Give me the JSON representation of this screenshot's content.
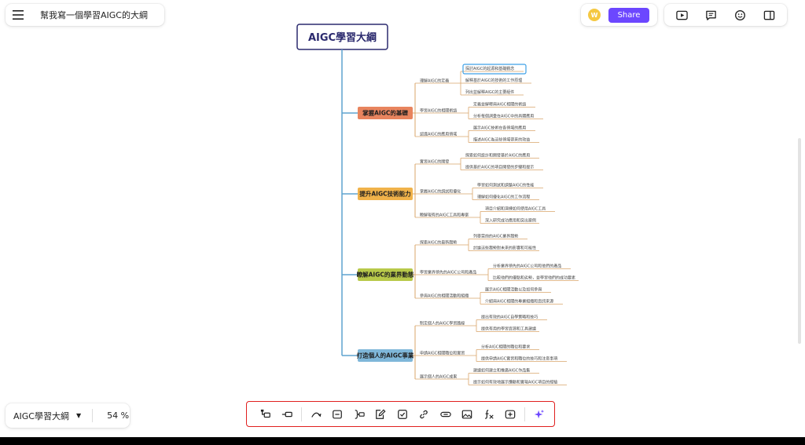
{
  "header": {
    "menu_icon": "hamburger-icon",
    "title": "幫我寫一個學習AIGC的大綱"
  },
  "share": {
    "avatar_letter": "W",
    "avatar_color": "#f5c842",
    "button_label": "Share",
    "button_color": "#6c47ff"
  },
  "top_tools": [
    "presentation-icon",
    "comment-icon",
    "emoji-icon",
    "panel-icon"
  ],
  "zoom": {
    "map_name": "AIGC學習大綱",
    "value": "54 %"
  },
  "bottom_toolbar": [
    "add-child-node-icon",
    "add-sibling-node-icon",
    "relationship-icon",
    "summary-icon",
    "boundary-icon",
    "note-icon",
    "task-icon",
    "link-icon",
    "hyperlink-icon",
    "image-icon",
    "formula-icon",
    "insert-icon",
    "ai-sparkle-icon"
  ],
  "mindmap": {
    "root": "AIGC學習大綱",
    "branches": [
      {
        "title": "掌握AIGC的基礎",
        "color": "#e8845e",
        "subs": [
          {
            "label": "理解AIGC的定義",
            "items": [
              "探討AIGC的起源和基礎觀念",
              "解釋基於AIGC的技術的工作原理",
              "列出並解釋AIGC的主要組件"
            ]
          },
          {
            "label": "學習AIGC的相關術語",
            "items": [
              "定義並解釋與AIGC相關的術語",
              "分析每個詞彙在AIGC中的具體應用"
            ]
          },
          {
            "label": "認識AIGC的應用領域",
            "items": [
              "展示AIGC技術在各領域的應用",
              "描述AIGC為這些領域帶來的效益"
            ]
          }
        ]
      },
      {
        "title": "提升AIGC技術能力",
        "color": "#f0b24a",
        "subs": [
          {
            "label": "實習AIGC的開發",
            "items": [
              "探索如何設計和開發基於AIGC的應用",
              "提供基於AIGC的項目開發的步驟和提示"
            ]
          },
          {
            "label": "掌握AIGC的調試和優化",
            "items": [
              "學習如何測試和調整AIGC的性能",
              "理解如何優化AIGC的工作流程"
            ]
          },
          {
            "label": "瞭解現有的AIGC工具和專案",
            "items": [
              "項目介紹和演練如何使用AIGC工具",
              "深入研究成功應用和突出案例"
            ]
          }
        ]
      },
      {
        "title": "瞭解AIGC的業界動態",
        "color": "#b8c94a",
        "subs": [
          {
            "label": "探索AIGC的最新趨勢",
            "items": [
              "列舉當前的AIGC業界趨勢",
              "討論這些趨勢對未來的影響和可能性"
            ]
          },
          {
            "label": "學習業界領先的AIGC公司和產品",
            "items": [
              "分析業界領先的AIGC公司和他們的產品",
              "比較他們的優點和劣勢，並學習他們的成功要素"
            ]
          },
          {
            "label": "參與AIGC的相關活動和組織",
            "items": [
              "展示AIGC相關活動以及如何參與",
              "介紹與AIGC相關的專業組織和資訊來源"
            ]
          }
        ]
      },
      {
        "title": "打造個人的AIGC事業",
        "color": "#7fb7d9",
        "subs": [
          {
            "label": "制定個人的AIGC學習路線",
            "items": [
              "提出有效的AIGC自學策略和技巧",
              "提供有用的學習資源和工具建議"
            ]
          },
          {
            "label": "申請AIGC相關職位和實習",
            "items": [
              "分析AIGC相關的職位和要求",
              "提供申請AIGC實習和職位的技巧和注意事項"
            ]
          },
          {
            "label": "展示個人的AIGC成果",
            "items": [
              "建議如何建立和推廣AIGC作品集",
              "提示如何有效地展示攬勳和實現AIGC項目的經驗"
            ]
          }
        ]
      }
    ]
  }
}
